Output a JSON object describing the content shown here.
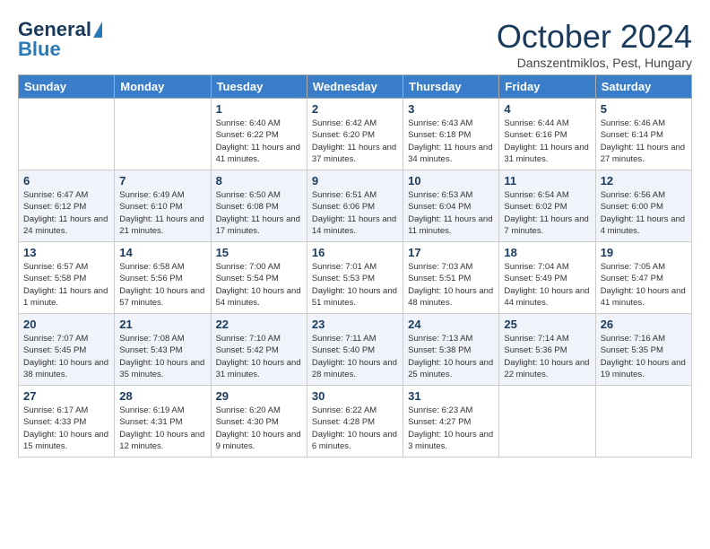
{
  "header": {
    "logo_line1": "General",
    "logo_line2": "Blue",
    "month": "October 2024",
    "location": "Danszentmiklos, Pest, Hungary"
  },
  "days_of_week": [
    "Sunday",
    "Monday",
    "Tuesday",
    "Wednesday",
    "Thursday",
    "Friday",
    "Saturday"
  ],
  "weeks": [
    [
      {
        "day": "",
        "info": ""
      },
      {
        "day": "",
        "info": ""
      },
      {
        "day": "1",
        "info": "Sunrise: 6:40 AM\nSunset: 6:22 PM\nDaylight: 11 hours and 41 minutes."
      },
      {
        "day": "2",
        "info": "Sunrise: 6:42 AM\nSunset: 6:20 PM\nDaylight: 11 hours and 37 minutes."
      },
      {
        "day": "3",
        "info": "Sunrise: 6:43 AM\nSunset: 6:18 PM\nDaylight: 11 hours and 34 minutes."
      },
      {
        "day": "4",
        "info": "Sunrise: 6:44 AM\nSunset: 6:16 PM\nDaylight: 11 hours and 31 minutes."
      },
      {
        "day": "5",
        "info": "Sunrise: 6:46 AM\nSunset: 6:14 PM\nDaylight: 11 hours and 27 minutes."
      }
    ],
    [
      {
        "day": "6",
        "info": "Sunrise: 6:47 AM\nSunset: 6:12 PM\nDaylight: 11 hours and 24 minutes."
      },
      {
        "day": "7",
        "info": "Sunrise: 6:49 AM\nSunset: 6:10 PM\nDaylight: 11 hours and 21 minutes."
      },
      {
        "day": "8",
        "info": "Sunrise: 6:50 AM\nSunset: 6:08 PM\nDaylight: 11 hours and 17 minutes."
      },
      {
        "day": "9",
        "info": "Sunrise: 6:51 AM\nSunset: 6:06 PM\nDaylight: 11 hours and 14 minutes."
      },
      {
        "day": "10",
        "info": "Sunrise: 6:53 AM\nSunset: 6:04 PM\nDaylight: 11 hours and 11 minutes."
      },
      {
        "day": "11",
        "info": "Sunrise: 6:54 AM\nSunset: 6:02 PM\nDaylight: 11 hours and 7 minutes."
      },
      {
        "day": "12",
        "info": "Sunrise: 6:56 AM\nSunset: 6:00 PM\nDaylight: 11 hours and 4 minutes."
      }
    ],
    [
      {
        "day": "13",
        "info": "Sunrise: 6:57 AM\nSunset: 5:58 PM\nDaylight: 11 hours and 1 minute."
      },
      {
        "day": "14",
        "info": "Sunrise: 6:58 AM\nSunset: 5:56 PM\nDaylight: 10 hours and 57 minutes."
      },
      {
        "day": "15",
        "info": "Sunrise: 7:00 AM\nSunset: 5:54 PM\nDaylight: 10 hours and 54 minutes."
      },
      {
        "day": "16",
        "info": "Sunrise: 7:01 AM\nSunset: 5:53 PM\nDaylight: 10 hours and 51 minutes."
      },
      {
        "day": "17",
        "info": "Sunrise: 7:03 AM\nSunset: 5:51 PM\nDaylight: 10 hours and 48 minutes."
      },
      {
        "day": "18",
        "info": "Sunrise: 7:04 AM\nSunset: 5:49 PM\nDaylight: 10 hours and 44 minutes."
      },
      {
        "day": "19",
        "info": "Sunrise: 7:05 AM\nSunset: 5:47 PM\nDaylight: 10 hours and 41 minutes."
      }
    ],
    [
      {
        "day": "20",
        "info": "Sunrise: 7:07 AM\nSunset: 5:45 PM\nDaylight: 10 hours and 38 minutes."
      },
      {
        "day": "21",
        "info": "Sunrise: 7:08 AM\nSunset: 5:43 PM\nDaylight: 10 hours and 35 minutes."
      },
      {
        "day": "22",
        "info": "Sunrise: 7:10 AM\nSunset: 5:42 PM\nDaylight: 10 hours and 31 minutes."
      },
      {
        "day": "23",
        "info": "Sunrise: 7:11 AM\nSunset: 5:40 PM\nDaylight: 10 hours and 28 minutes."
      },
      {
        "day": "24",
        "info": "Sunrise: 7:13 AM\nSunset: 5:38 PM\nDaylight: 10 hours and 25 minutes."
      },
      {
        "day": "25",
        "info": "Sunrise: 7:14 AM\nSunset: 5:36 PM\nDaylight: 10 hours and 22 minutes."
      },
      {
        "day": "26",
        "info": "Sunrise: 7:16 AM\nSunset: 5:35 PM\nDaylight: 10 hours and 19 minutes."
      }
    ],
    [
      {
        "day": "27",
        "info": "Sunrise: 6:17 AM\nSunset: 4:33 PM\nDaylight: 10 hours and 15 minutes."
      },
      {
        "day": "28",
        "info": "Sunrise: 6:19 AM\nSunset: 4:31 PM\nDaylight: 10 hours and 12 minutes."
      },
      {
        "day": "29",
        "info": "Sunrise: 6:20 AM\nSunset: 4:30 PM\nDaylight: 10 hours and 9 minutes."
      },
      {
        "day": "30",
        "info": "Sunrise: 6:22 AM\nSunset: 4:28 PM\nDaylight: 10 hours and 6 minutes."
      },
      {
        "day": "31",
        "info": "Sunrise: 6:23 AM\nSunset: 4:27 PM\nDaylight: 10 hours and 3 minutes."
      },
      {
        "day": "",
        "info": ""
      },
      {
        "day": "",
        "info": ""
      }
    ]
  ]
}
